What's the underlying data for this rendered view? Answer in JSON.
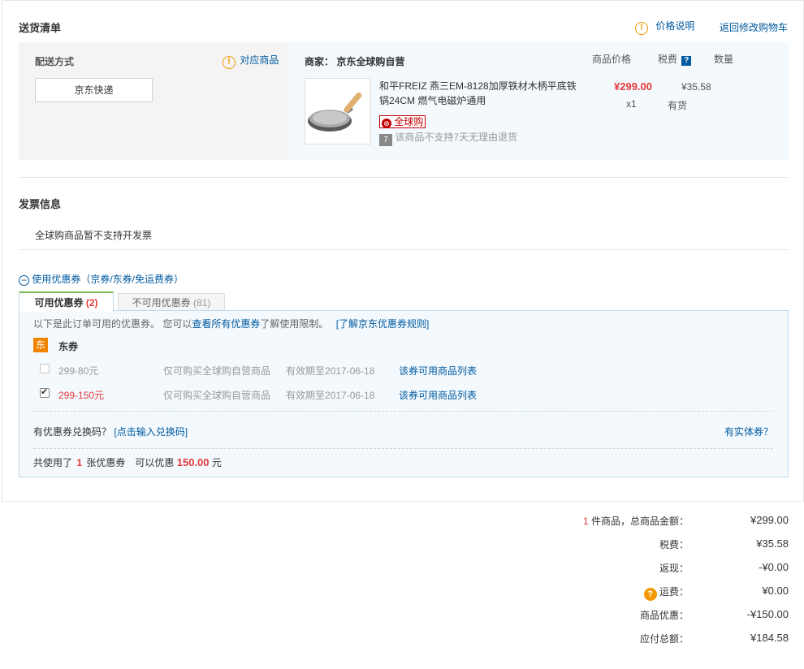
{
  "delivery": {
    "title": "送货清单",
    "price_note": "价格说明",
    "back_cart": "返回修改购物车",
    "ship_method_label": "配送方式",
    "match_goods": "对应商品",
    "ship_option": "京东快递",
    "merchant_label": "商家：",
    "merchant_name": "京东全球购自营",
    "col_price": "商品价格",
    "col_tax": "税费",
    "col_tax_badge": "?",
    "col_qty": "数量",
    "product_name": "和平FREIZ 燕三EM-8128加厚铁材木柄平底铁锅24CM 燃气电磁炉通用",
    "product_price": "¥299.00",
    "product_tax": "¥35.58",
    "product_qty": "x1",
    "product_stock": "有货",
    "global_tag": "全球购",
    "no_return_badge": "7",
    "no_return_text": "该商品不支持7天无理由退货"
  },
  "invoice": {
    "title": "发票信息",
    "note": "全球购商品暂不支持开发票"
  },
  "coupon": {
    "toggle_icon": "−",
    "toggle_label": "使用优惠券（京券/东券/免运费券）",
    "tab_available_label": "可用优惠券",
    "tab_available_count": "(2)",
    "tab_unavailable_label": "不可用优惠券",
    "tab_unavailable_count": "(81)",
    "intro_prefix": "以下是此订单可用的优惠券。 您可以",
    "intro_link": "查看所有优惠券",
    "intro_suffix": "了解使用限制。",
    "rules_link": "[了解京东优惠券规则]",
    "group_badge": "东",
    "group_label": "东券",
    "items": [
      {
        "name": "299-80元",
        "scope": "仅可购买全球购自营商品",
        "expiry": "有效期至2017-06-18",
        "link": "该券可用商品列表",
        "checked": false
      },
      {
        "name": "299-150元",
        "scope": "仅可购买全球购自营商品",
        "expiry": "有效期至2017-06-18",
        "link": "该券可用商品列表",
        "checked": true
      }
    ],
    "redeem_prefix": "有优惠券兑换码？",
    "redeem_link": "[点击输入兑换码]",
    "physical_link": "有实体券？",
    "used_prefix": "共使用了",
    "used_count": "1",
    "used_mid": "张优惠券　可以优惠",
    "used_amount": "150.00",
    "used_suffix": "元"
  },
  "summary": {
    "count": "1",
    "goods_total_label": "件商品，总商品金额：",
    "goods_total": "¥299.00",
    "tax_label": "税费：",
    "tax": "¥35.58",
    "cashback_label": "返现：",
    "cashback": "-¥0.00",
    "freight_icon": "?",
    "freight_label": "运费：",
    "freight": "¥0.00",
    "discount_label": "商品优惠：",
    "discount": "-¥150.00",
    "payable_label": "应付总额：",
    "payable": "¥184.58"
  }
}
